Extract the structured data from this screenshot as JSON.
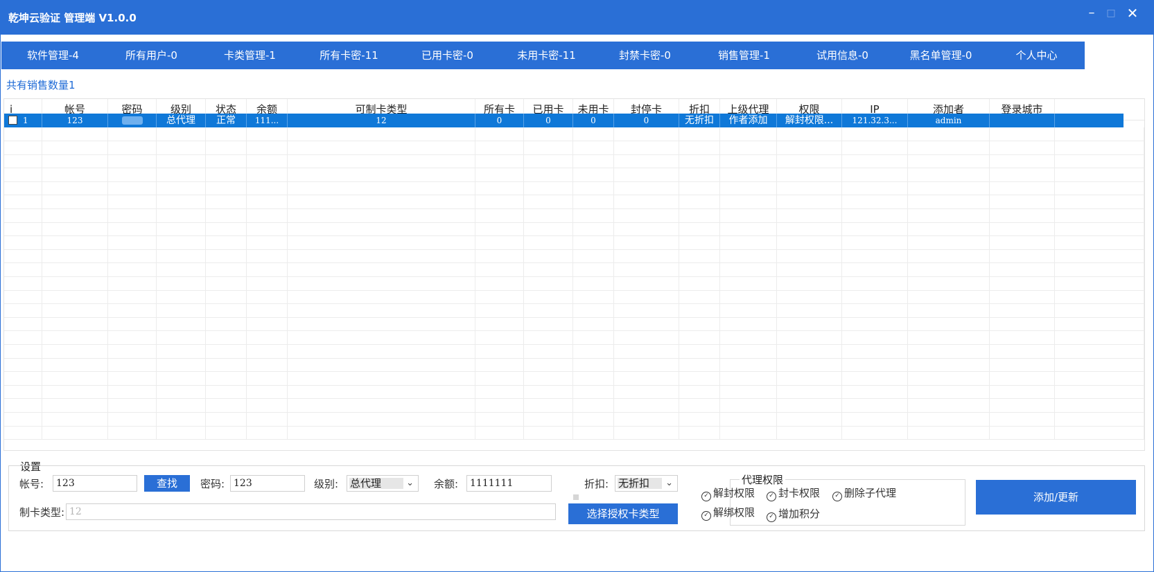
{
  "window": {
    "title": "乾坤云验证 管理端 V1.0.0",
    "minimize_glyph": "–",
    "maximize_glyph": "□",
    "close_glyph": "✕"
  },
  "nav_tabs": [
    "软件管理-4",
    "所有用户-0",
    "卡类管理-1",
    "所有卡密-11",
    "已用卡密-0",
    "未用卡密-11",
    "封禁卡密-0",
    "销售管理-1",
    "试用信息-0",
    "黑名单管理-0",
    "个人中心"
  ],
  "sales_count_text": "共有销售数量1",
  "table": {
    "columns": [
      "i",
      "帐号",
      "密码",
      "级别",
      "状态",
      "余额",
      "可制卡类型",
      "所有卡",
      "已用卡",
      "未用卡",
      "封停卡",
      "折扣",
      "上级代理",
      "权限",
      "IP",
      "添加者",
      "登录城市"
    ],
    "rows": [
      {
        "i": "1",
        "account": "123",
        "password": "",
        "level": "总代理",
        "status": "正常",
        "balance": "111...",
        "card_types": "12",
        "all_cards": "0",
        "used_cards": "0",
        "unused_cards": "0",
        "banned_cards": "0",
        "discount": "无折扣",
        "parent_agent": "作者添加",
        "permissions": "解封权限...",
        "ip": "121.32.3...",
        "added_by": "admin",
        "login_city": ""
      }
    ],
    "selected_row": 0
  },
  "settings": {
    "legend": "设置",
    "account_label": "帐号:",
    "account_value": "123",
    "find_button": "查找",
    "password_label": "密码:",
    "password_value": "123",
    "level_label": "级别:",
    "level_value": "总代理",
    "balance_label": "余额:",
    "balance_value": "1111111",
    "discount_label": "折扣:",
    "discount_value": "无折扣",
    "card_type_label": "制卡类型:",
    "card_type_value": "12",
    "select_card_type_button": "选择授权卡类型",
    "add_update_button": "添加/更新"
  },
  "agent_permissions": {
    "legend": "代理权限",
    "items": [
      {
        "label": "解封权限",
        "checked": true
      },
      {
        "label": "封卡权限",
        "checked": true
      },
      {
        "label": "删除子代理",
        "checked": true
      },
      {
        "label": "解绑权限",
        "checked": true
      },
      {
        "label": "增加积分",
        "checked": true
      }
    ]
  },
  "colors": {
    "accent": "#2a6fd6",
    "selected_row": "#0f78d8",
    "link_text": "#1e6ad6"
  }
}
